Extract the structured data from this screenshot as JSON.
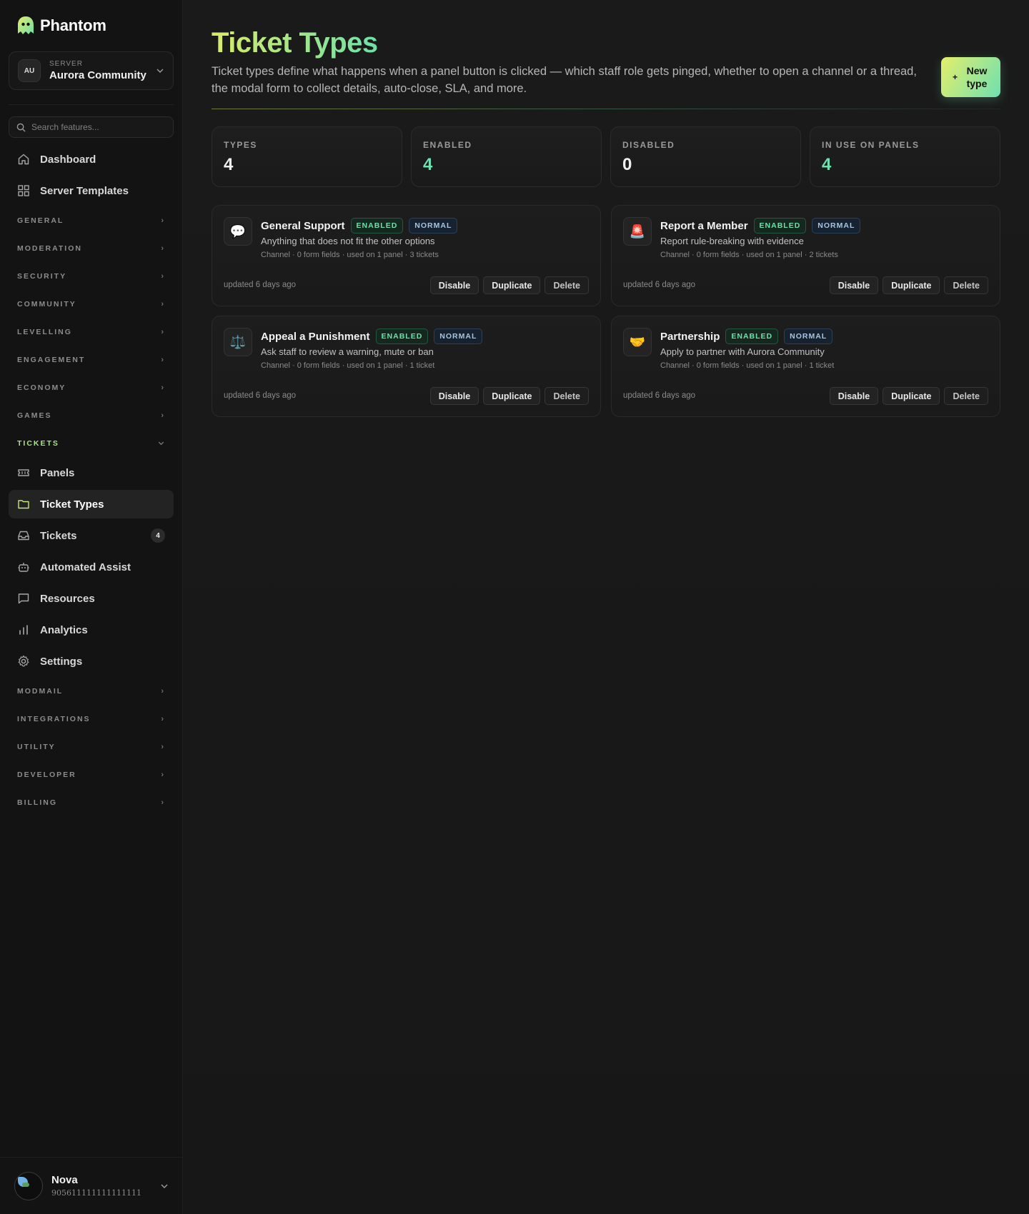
{
  "brand": {
    "name": "Phantom"
  },
  "server": {
    "label": "SERVER",
    "initials": "AU",
    "name": "Aurora Community"
  },
  "search": {
    "placeholder": "Search features..."
  },
  "nav_top": [
    {
      "label": "Dashboard",
      "icon": "home-icon"
    },
    {
      "label": "Server Templates",
      "icon": "grid-icon"
    }
  ],
  "sections_before": [
    "GENERAL",
    "MODERATION",
    "SECURITY",
    "COMMUNITY",
    "LEVELLING",
    "ENGAGEMENT",
    "ECONOMY",
    "GAMES"
  ],
  "tickets_section": {
    "label": "TICKETS",
    "items": [
      {
        "label": "Panels",
        "icon": "ticket-icon"
      },
      {
        "label": "Ticket Types",
        "icon": "folder-icon",
        "active": true
      },
      {
        "label": "Tickets",
        "icon": "inbox-icon",
        "count": "4"
      },
      {
        "label": "Automated Assist",
        "icon": "robot-icon"
      },
      {
        "label": "Resources",
        "icon": "message-icon"
      },
      {
        "label": "Analytics",
        "icon": "bar-chart-icon"
      },
      {
        "label": "Settings",
        "icon": "gear-icon"
      }
    ]
  },
  "sections_after": [
    "MODMAIL",
    "INTEGRATIONS",
    "UTILITY",
    "DEVELOPER",
    "BILLING"
  ],
  "user": {
    "name": "Nova",
    "id": "905611111111111111"
  },
  "page": {
    "title": "Ticket Types",
    "description": "Ticket types define what happens when a panel button is clicked — which staff role gets pinged, whether to open a channel or a thread, the modal form to collect details, auto-close, SLA, and more.",
    "new_button_plus": "+",
    "new_button_label": "New type"
  },
  "stats": [
    {
      "label": "TYPES",
      "value": "4",
      "tone": "white"
    },
    {
      "label": "ENABLED",
      "value": "4",
      "tone": "green"
    },
    {
      "label": "DISABLED",
      "value": "0",
      "tone": "white"
    },
    {
      "label": "IN USE ON PANELS",
      "value": "4",
      "tone": "green"
    }
  ],
  "ticket_types": [
    {
      "emoji": "💬",
      "icon": "speech-bubble-icon",
      "title": "General Support",
      "status": "ENABLED",
      "priority": "NORMAL",
      "description": "Anything that does not fit the other options",
      "meta": "Channel · 0 form fields · used on 1 panel · 3 tickets",
      "updated": "updated 6 days ago"
    },
    {
      "emoji": "🚨",
      "icon": "siren-icon",
      "title": "Report a Member",
      "status": "ENABLED",
      "priority": "NORMAL",
      "description": "Report rule-breaking with evidence",
      "meta": "Channel · 0 form fields · used on 1 panel · 2 tickets",
      "updated": "updated 6 days ago"
    },
    {
      "emoji": "⚖️",
      "icon": "scales-icon",
      "title": "Appeal a Punishment",
      "status": "ENABLED",
      "priority": "NORMAL",
      "description": "Ask staff to review a warning, mute or ban",
      "meta": "Channel · 0 form fields · used on 1 panel · 1 ticket",
      "updated": "updated 6 days ago"
    },
    {
      "emoji": "🤝",
      "icon": "handshake-icon",
      "title": "Partnership",
      "status": "ENABLED",
      "priority": "NORMAL",
      "description": "Apply to partner with Aurora Community",
      "meta": "Channel · 0 form fields · used on 1 panel · 1 ticket",
      "updated": "updated 6 days ago"
    }
  ],
  "actions": {
    "disable": "Disable",
    "duplicate": "Duplicate",
    "delete": "Delete"
  }
}
